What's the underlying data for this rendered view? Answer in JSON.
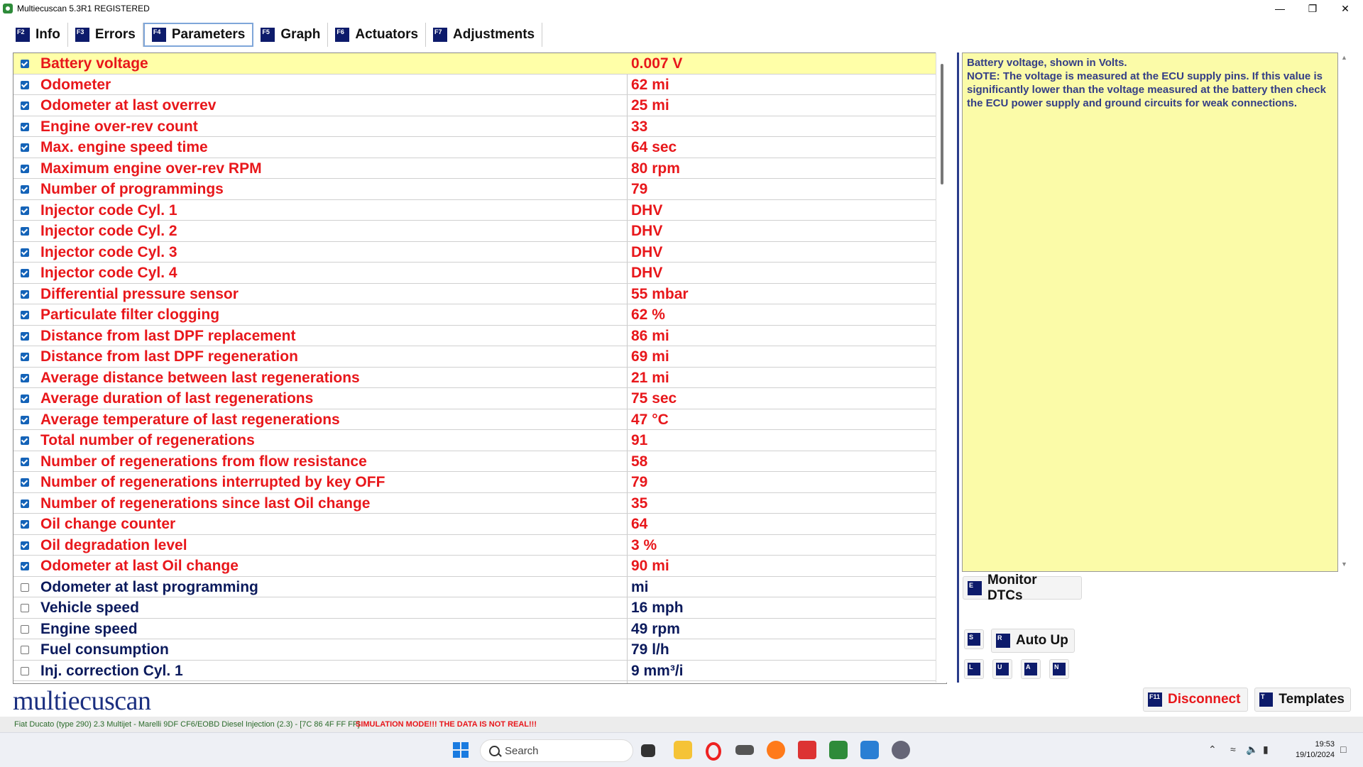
{
  "window": {
    "title": "Multiecuscan 5.3R1 REGISTERED"
  },
  "tabs": [
    {
      "key": "F2",
      "label": "Info"
    },
    {
      "key": "F3",
      "label": "Errors"
    },
    {
      "key": "F4",
      "label": "Parameters"
    },
    {
      "key": "F5",
      "label": "Graph"
    },
    {
      "key": "F6",
      "label": "Actuators"
    },
    {
      "key": "F7",
      "label": "Adjustments"
    }
  ],
  "parameters": [
    {
      "name": "Battery voltage",
      "value": "0.007 V",
      "checked": true
    },
    {
      "name": "Odometer",
      "value": "62 mi",
      "checked": true
    },
    {
      "name": "Odometer at last overrev",
      "value": "25 mi",
      "checked": true
    },
    {
      "name": "Engine over-rev count",
      "value": "33",
      "checked": true
    },
    {
      "name": "Max. engine speed time",
      "value": "64 sec",
      "checked": true
    },
    {
      "name": "Maximum engine over-rev RPM",
      "value": "80 rpm",
      "checked": true
    },
    {
      "name": "Number of programmings",
      "value": "79",
      "checked": true
    },
    {
      "name": "Injector code Cyl. 1",
      "value": "DHV",
      "checked": true
    },
    {
      "name": "Injector code Cyl. 2",
      "value": "DHV",
      "checked": true
    },
    {
      "name": "Injector code Cyl. 3",
      "value": "DHV",
      "checked": true
    },
    {
      "name": "Injector code Cyl. 4",
      "value": "DHV",
      "checked": true
    },
    {
      "name": "Differential pressure sensor",
      "value": "55 mbar",
      "checked": true
    },
    {
      "name": "Particulate filter clogging",
      "value": "62 %",
      "checked": true
    },
    {
      "name": "Distance from last DPF replacement",
      "value": "86 mi",
      "checked": true
    },
    {
      "name": "Distance from last DPF regeneration",
      "value": "69 mi",
      "checked": true
    },
    {
      "name": "Average distance between last regenerations",
      "value": "21 mi",
      "checked": true
    },
    {
      "name": "Average duration of last regenerations",
      "value": "75 sec",
      "checked": true
    },
    {
      "name": "Average temperature of last regenerations",
      "value": "47 °C",
      "checked": true
    },
    {
      "name": "Total number of regenerations",
      "value": "91",
      "checked": true
    },
    {
      "name": "Number of regenerations from flow resistance",
      "value": "58",
      "checked": true
    },
    {
      "name": "Number of regenerations interrupted by key OFF",
      "value": "79",
      "checked": true
    },
    {
      "name": "Number of regenerations since last Oil change",
      "value": "35",
      "checked": true
    },
    {
      "name": "Oil change counter",
      "value": "64",
      "checked": true
    },
    {
      "name": "Oil degradation level",
      "value": "3 %",
      "checked": true
    },
    {
      "name": "Odometer at last Oil change",
      "value": "90 mi",
      "checked": true
    },
    {
      "name": "Odometer at last programming",
      "value": " mi",
      "checked": false
    },
    {
      "name": "Vehicle speed",
      "value": "16 mph",
      "checked": false
    },
    {
      "name": "Engine speed",
      "value": "49 rpm",
      "checked": false
    },
    {
      "name": "Fuel consumption",
      "value": "79 l/h",
      "checked": false
    },
    {
      "name": "Inj. correction Cyl. 1",
      "value": "9 mm³/i",
      "checked": false
    }
  ],
  "description": {
    "line1": "Battery voltage, shown in Volts.",
    "line2": "NOTE: The voltage is measured at the ECU supply pins. If this value is significantly lower than the voltage measured at the battery then check the ECU power supply and ground circuits for weak connections."
  },
  "buttons": {
    "monitor_dtcs": {
      "key": "E",
      "label": "Monitor DTCs"
    },
    "s_key": "S",
    "auto_up": {
      "key": "R",
      "label": "Auto Up"
    },
    "l_key": "L",
    "u_key": "U",
    "a_key": "A",
    "n_key": "N",
    "disconnect": {
      "key": "F11",
      "label": "Disconnect"
    },
    "templates": {
      "key": "T",
      "label": "Templates"
    }
  },
  "logo": "multiecuscan",
  "status": {
    "vehicle": "Fiat Ducato (type 290) 2.3 Multijet - Marelli 9DF CF6/EOBD Diesel Injection (2.3) - [7C 86 4F FF FF]",
    "simulation": "SIMULATION MODE!!! THE DATA IS NOT REAL!!!"
  },
  "taskbar": {
    "search_placeholder": "Search",
    "time": "19:53",
    "date": "19/10/2024"
  },
  "colors": {
    "active_param": "#e8171b",
    "inactive_param": "#0b1a5c",
    "selected_row": "#ffffa8",
    "description_bg": "#fbfba8",
    "badge": "#0d1b6b"
  }
}
